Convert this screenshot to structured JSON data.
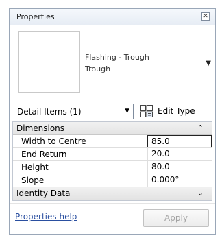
{
  "window": {
    "title": "Properties",
    "close_glyph": "✕"
  },
  "type_selector": {
    "family": "Flashing - Trough",
    "type": "Trough",
    "arrow": "▼"
  },
  "filter": {
    "label": "Detail Items (1)",
    "arrow": "▼"
  },
  "edit_type": {
    "label": "Edit Type",
    "icon": "edit-type-icon"
  },
  "groups": [
    {
      "label": "Dimensions",
      "chevron": "⌃",
      "expanded": true,
      "params": [
        {
          "name": "Width to Centre",
          "value": "85.0"
        },
        {
          "name": "End Return",
          "value": "20.0"
        },
        {
          "name": "Height",
          "value": "80.0"
        },
        {
          "name": "Slope",
          "value": "0.000°"
        }
      ]
    },
    {
      "label": "Identity Data",
      "chevron": "⌄",
      "expanded": false
    }
  ],
  "footer": {
    "help_link": "Properties help",
    "apply_label": "Apply"
  }
}
